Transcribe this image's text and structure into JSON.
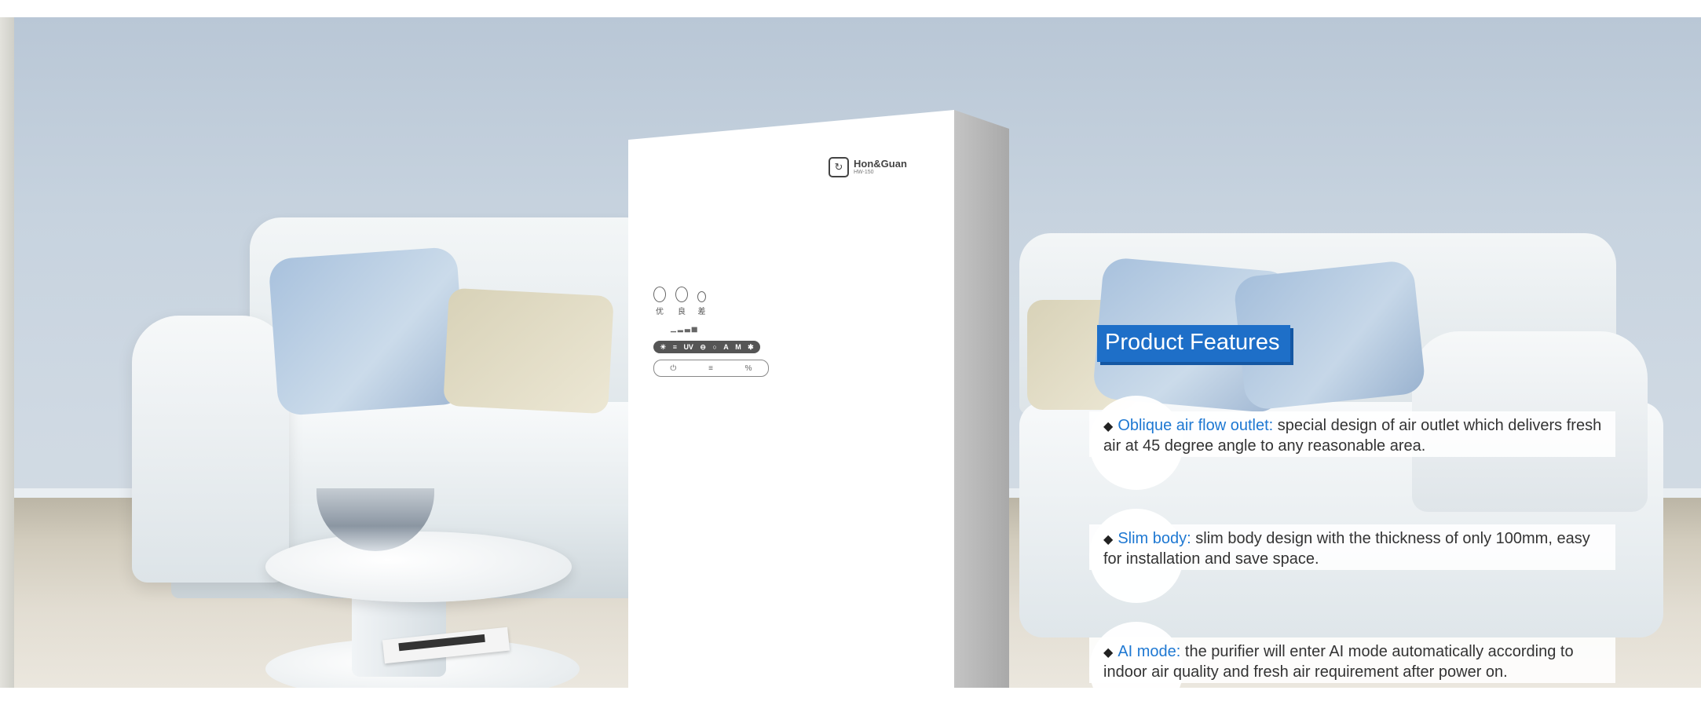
{
  "brand": {
    "name": "Hon&Guan",
    "model": "HW-150"
  },
  "panel": {
    "indicators": [
      "优",
      "良",
      "差"
    ],
    "status_strip": [
      "☀",
      "≡",
      "UV",
      "⊖",
      "○",
      "A",
      "M",
      "✱"
    ],
    "buttons": [
      "⏻",
      "≡",
      "%"
    ]
  },
  "features": {
    "title": "Product Features",
    "items": [
      {
        "lead": "Oblique air flow outlet:",
        "text": " special design of air outlet which delivers fresh air at 45 degree angle to any reasonable area."
      },
      {
        "lead": "Slim body:",
        "text": " slim body design with the thickness of only 100mm, easy for installation and save space."
      },
      {
        "lead": "AI mode:",
        "text": " the purifier will enter AI mode automatically according to indoor air quality and fresh air requirement after power on."
      }
    ]
  },
  "colors": {
    "accent": "#1e6fc8",
    "lead_text": "#1e78d2"
  }
}
